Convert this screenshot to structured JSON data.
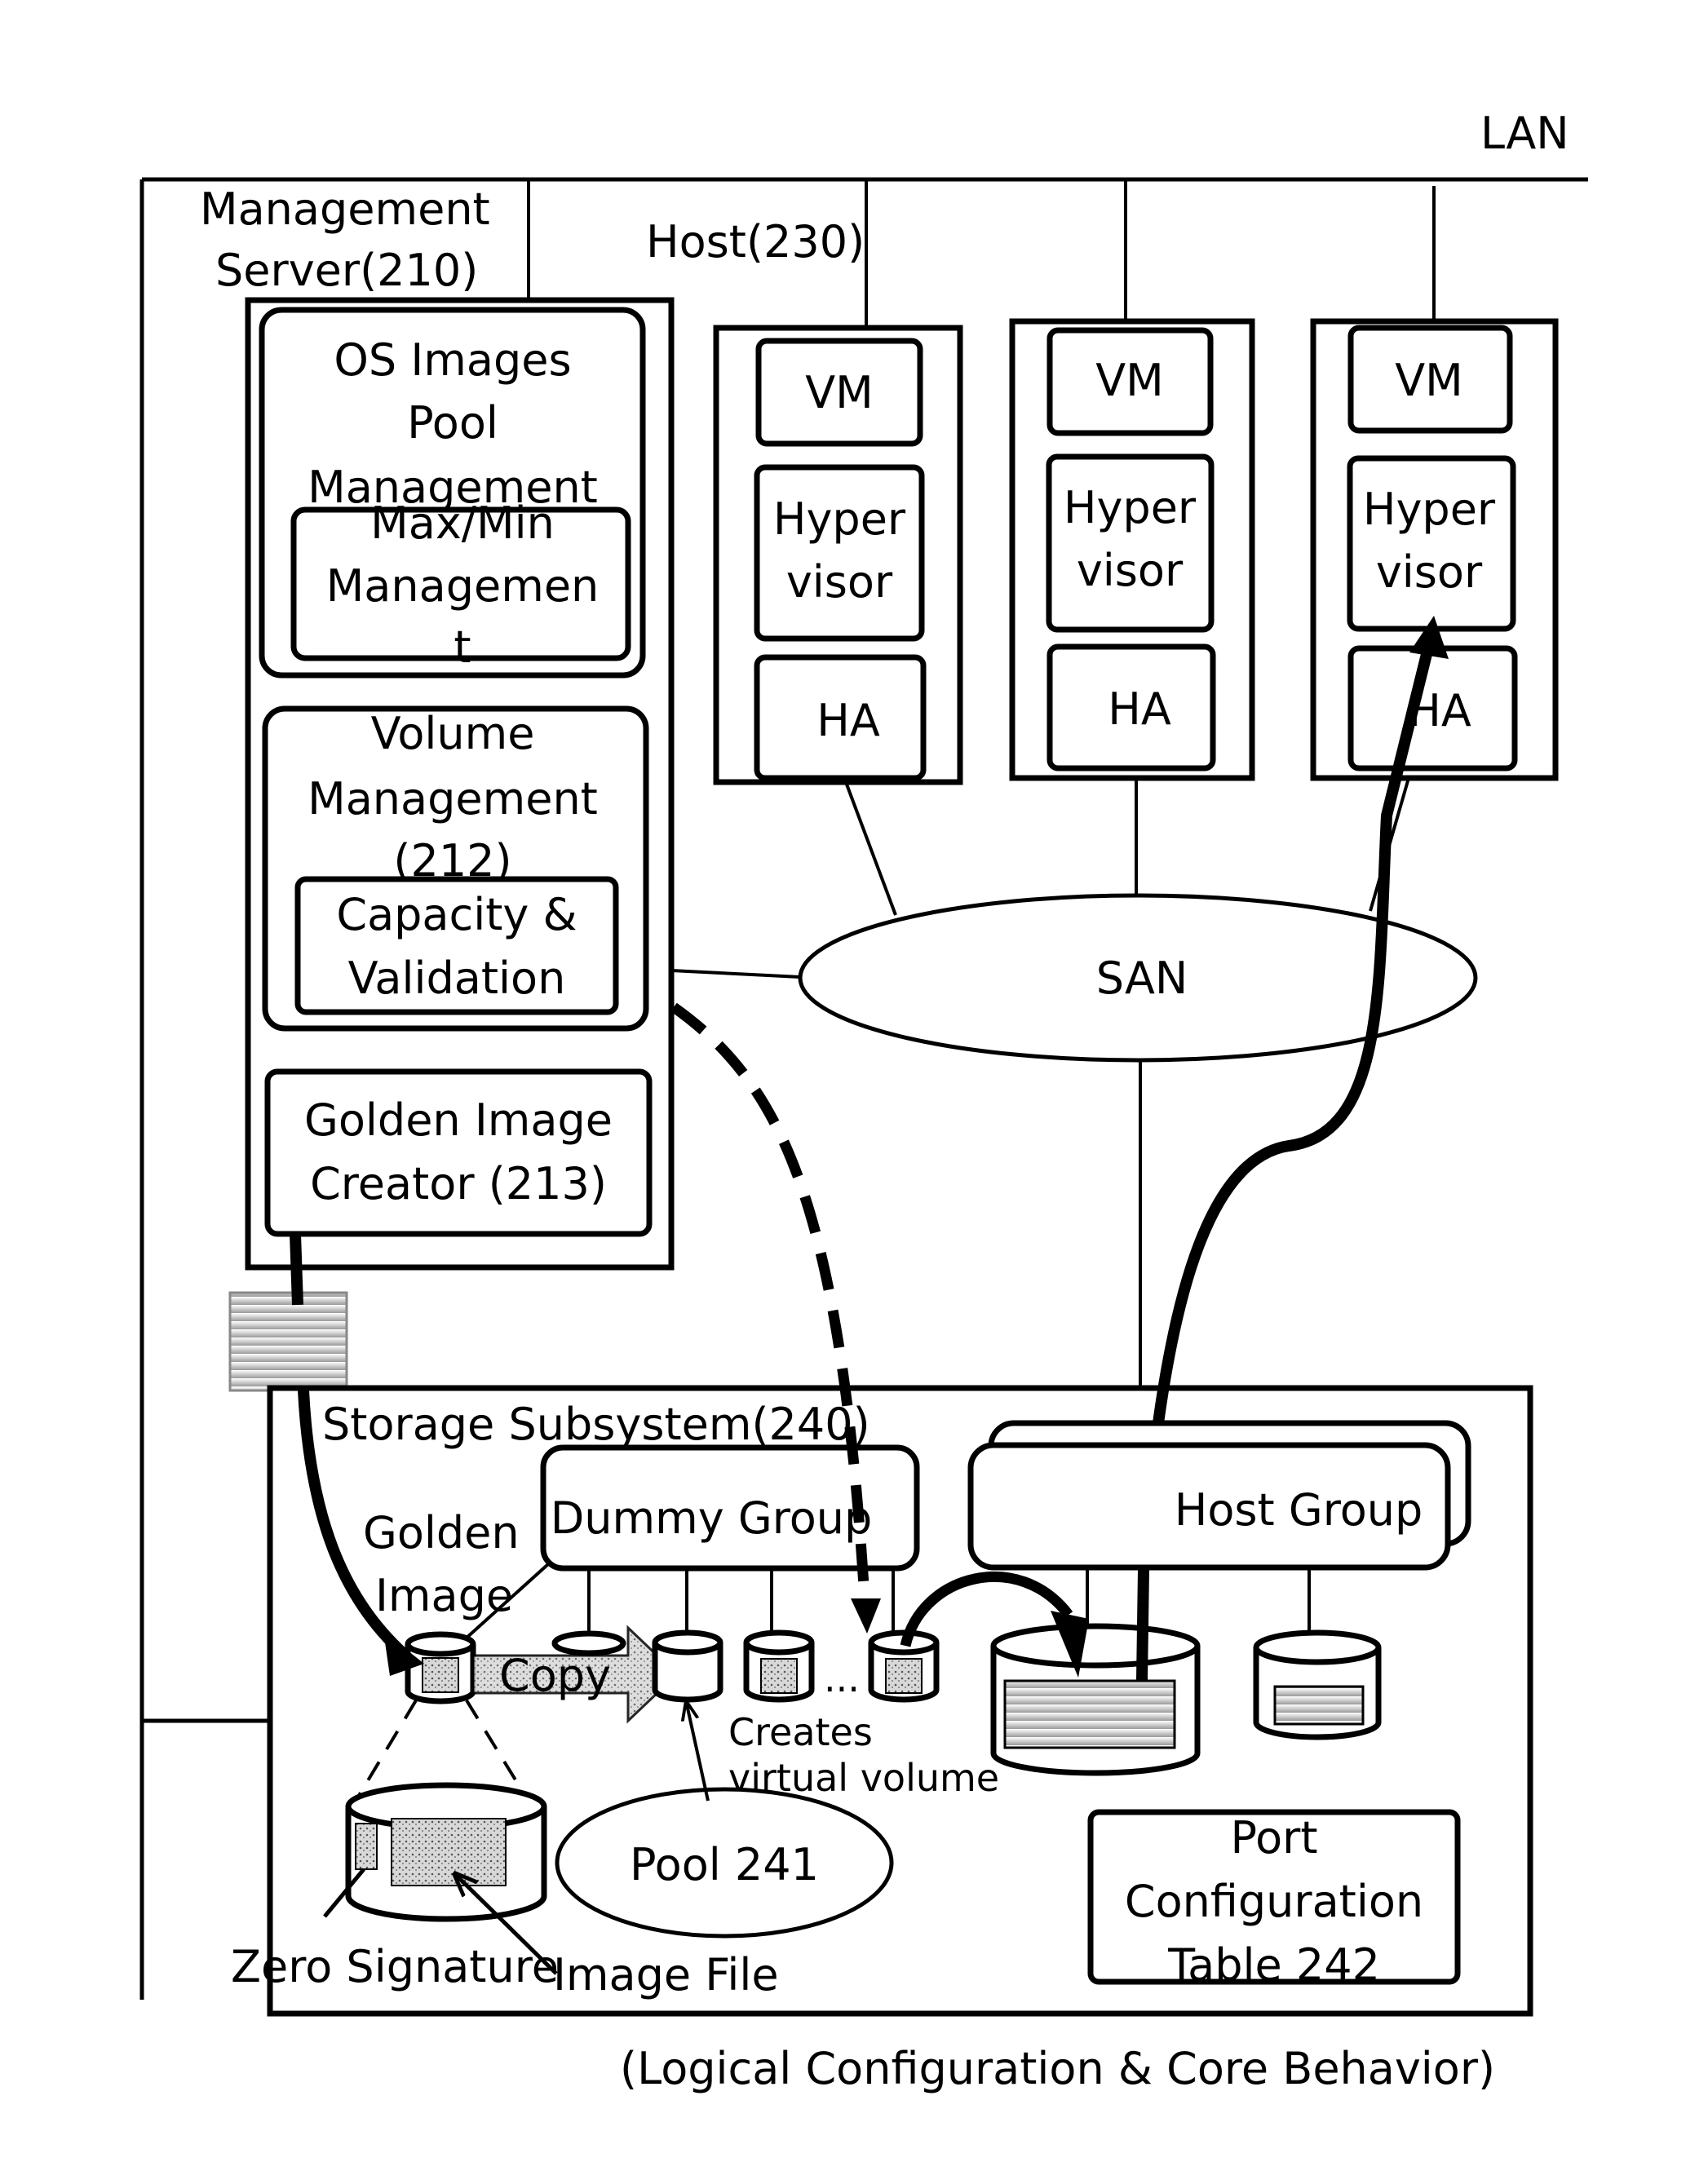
{
  "network": {
    "lan_label": "LAN",
    "san_label": "SAN"
  },
  "management_server": {
    "title_line1": "Management",
    "title_line2": "Server(210)",
    "os_images_pool": {
      "line1": "OS Images",
      "line2": "Pool",
      "line3": "Management",
      "maxmin_line1": "Max/Min",
      "maxmin_line2": "Managemen",
      "maxmin_line3": "t"
    },
    "volume_management": {
      "line1": "Volume",
      "line2": "Management",
      "line3": "(212)",
      "capacity_line1": "Capacity &",
      "capacity_line2": "Validation"
    },
    "golden_image_creator": {
      "line1": "Golden Image",
      "line2": "Creator (213)"
    }
  },
  "hosts": {
    "label": "Host(230)",
    "items": [
      {
        "vm": "VM",
        "hyper1": "Hyper",
        "hyper2": "visor",
        "ha": "HA"
      },
      {
        "vm": "VM",
        "hyper1": "Hyper",
        "hyper2": "visor",
        "ha": "HA"
      },
      {
        "vm": "VM",
        "hyper1": "Hyper",
        "hyper2": "visor",
        "ha": "HA"
      }
    ]
  },
  "storage": {
    "title": "Storage Subsystem(240)",
    "dummy_group": "Dummy Group",
    "host_group": "Host Group",
    "golden_image_line1": "Golden",
    "golden_image_line2": "Image",
    "copy_label": "Copy",
    "ellipsis": "...",
    "creates_line1": "Creates",
    "creates_line2": "virtual volume",
    "pool_label": "Pool 241",
    "zero_signature": "Zero Signature",
    "image_file": "Image File",
    "port_config_line1": "Port",
    "port_config_line2": "Configuration",
    "port_config_line3": "Table 242"
  },
  "caption": "(Logical Configuration & Core Behavior)"
}
